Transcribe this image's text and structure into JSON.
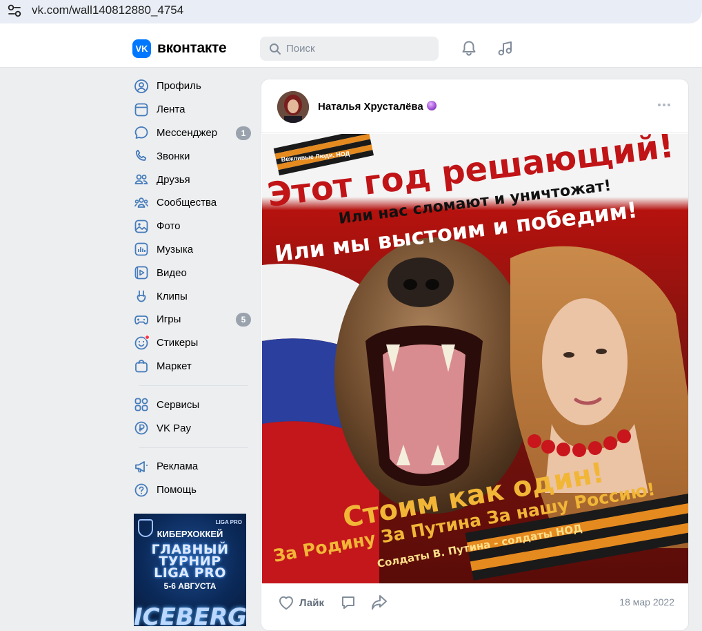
{
  "browser": {
    "url": "vk.com/wall140812880_4754"
  },
  "header": {
    "logo_mark": "VK",
    "logo_text": "вконтакте",
    "search_placeholder": "Поиск"
  },
  "sidebar": {
    "items": [
      {
        "label": "Профиль",
        "icon": "profile-icon"
      },
      {
        "label": "Лента",
        "icon": "feed-icon"
      },
      {
        "label": "Мессенджер",
        "icon": "messenger-icon",
        "badge": "1"
      },
      {
        "label": "Звонки",
        "icon": "calls-icon"
      },
      {
        "label": "Друзья",
        "icon": "friends-icon"
      },
      {
        "label": "Сообщества",
        "icon": "communities-icon"
      },
      {
        "label": "Фото",
        "icon": "photo-icon"
      },
      {
        "label": "Музыка",
        "icon": "music-icon"
      },
      {
        "label": "Видео",
        "icon": "video-icon"
      },
      {
        "label": "Клипы",
        "icon": "clips-icon"
      },
      {
        "label": "Игры",
        "icon": "games-icon",
        "badge": "5"
      },
      {
        "label": "Стикеры",
        "icon": "stickers-icon"
      },
      {
        "label": "Маркет",
        "icon": "market-icon"
      }
    ],
    "items2": [
      {
        "label": "Сервисы",
        "icon": "services-icon"
      },
      {
        "label": "VK Pay",
        "icon": "vkpay-icon"
      }
    ],
    "items3": [
      {
        "label": "Реклама",
        "icon": "ads-icon"
      },
      {
        "label": "Помощь",
        "icon": "help-icon"
      }
    ],
    "ad": {
      "line1": "КИБЕРХОККЕЙ",
      "line2a": "ГЛАВНЫЙ",
      "line2b": "ТУРНИР",
      "line2c": "LIGA PRO",
      "line3": "5-6 АВГУСТА",
      "line4": "ICEBERG",
      "logo_right": "LIGA PRO"
    }
  },
  "post": {
    "author": "Наталья Хрусталёва",
    "image_text": {
      "watermark": "Вежливые Люди. НОД",
      "headline": "Этот год решающий!",
      "line2": "Или нас сломают и уничтожат!",
      "line3": "Или мы выстоим и победим!",
      "slogan1": "Стоим как один!",
      "slogan2": "За Родину За Путина За нашу Россию!",
      "slogan3": "Солдаты В. Путина - солдаты НОД"
    },
    "like_label": "Лайк",
    "date": "18 мар 2022"
  },
  "colors": {
    "accent": "#0077ff",
    "badge": "#99a2ad",
    "text_secondary": "#818c99",
    "action": "#626d7a"
  }
}
